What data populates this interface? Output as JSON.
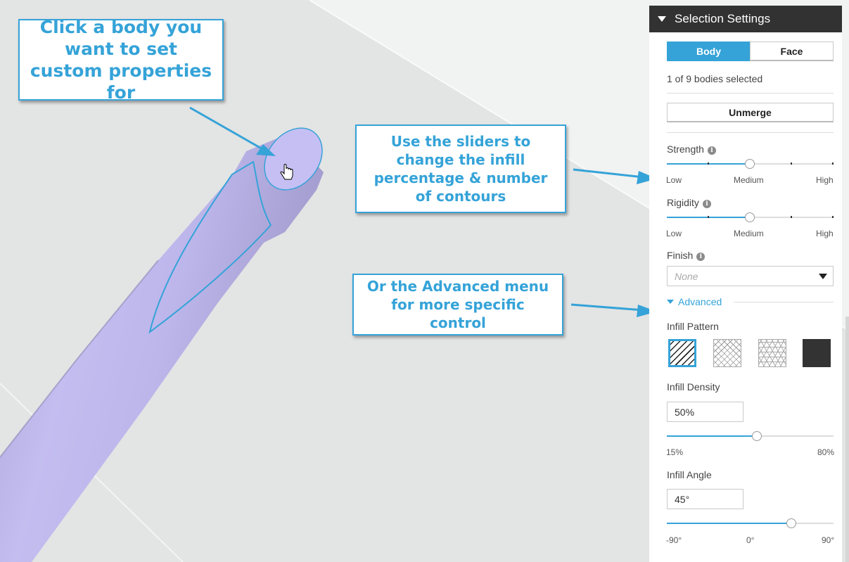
{
  "callouts": {
    "click_body": "Click a body you want to set custom properties for",
    "sliders": "Use the sliders to change the infill percentage & number of contours",
    "advanced": "Or the Advanced menu for more specific control"
  },
  "panel": {
    "title": "Selection Settings",
    "mode_tabs": {
      "body": "Body",
      "face": "Face",
      "selected": "Body"
    },
    "selection_status": "1 of 9 bodies selected",
    "unmerge_label": "Unmerge",
    "strength": {
      "label": "Strength",
      "min_label": "Low",
      "mid_label": "Medium",
      "max_label": "High",
      "value_fraction": 0.5
    },
    "rigidity": {
      "label": "Rigidity",
      "min_label": "Low",
      "mid_label": "Medium",
      "max_label": "High",
      "value_fraction": 0.5
    },
    "finish": {
      "label": "Finish",
      "placeholder": "None"
    },
    "advanced_label": "Advanced",
    "infill_pattern": {
      "label": "Infill Pattern",
      "options": [
        "diagonal-lines",
        "crosshatch",
        "triangles",
        "solid"
      ],
      "selected": "diagonal-lines"
    },
    "infill_density": {
      "label": "Infill Density",
      "value": "50%",
      "min_label": "15%",
      "max_label": "80%",
      "value_fraction": 0.54
    },
    "infill_angle": {
      "label": "Infill Angle",
      "value": "45°",
      "min_label": "-90°",
      "mid_label": "0°",
      "max_label": "90°",
      "value_fraction": 0.75
    }
  },
  "colors": {
    "accent": "#35a3d8",
    "header_bg": "#323232",
    "model": "#c4bdf0",
    "viewport_bg": "#e2e3e3"
  }
}
